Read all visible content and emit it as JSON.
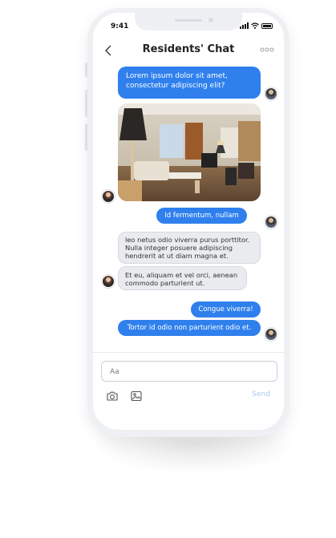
{
  "status": {
    "time": "9:41"
  },
  "header": {
    "title": "Residents' Chat",
    "back_icon": "chevron-left-icon",
    "more_icon": "more-horizontal-icon"
  },
  "messages": [
    {
      "side": "out",
      "text": "Lorem ipsum dolor sit amet, consectetur adipiscing elit?"
    },
    {
      "side": "in",
      "type": "image",
      "image": "living-room-photo"
    },
    {
      "side": "out",
      "text": "Id fermentum, nullam"
    },
    {
      "side": "in",
      "text": "leo netus odio viverra purus porttitor. Nulla integer posuere adipiscing hendrerit at ut diam magna et."
    },
    {
      "side": "in",
      "text": "Et eu, aliquam et vel orci, aenean commodo parturient ut."
    },
    {
      "side": "out",
      "text": "Congue viverra!"
    },
    {
      "side": "out",
      "text": "Tortor id odio non parturient odio et."
    }
  ],
  "composer": {
    "placeholder": "Aa",
    "send_label": "Send",
    "camera_icon": "camera-icon",
    "image_icon": "image-icon"
  },
  "colors": {
    "accent": "#2f80ed",
    "incoming_bg": "#e9ebef",
    "send_disabled": "#a9c8f5"
  }
}
